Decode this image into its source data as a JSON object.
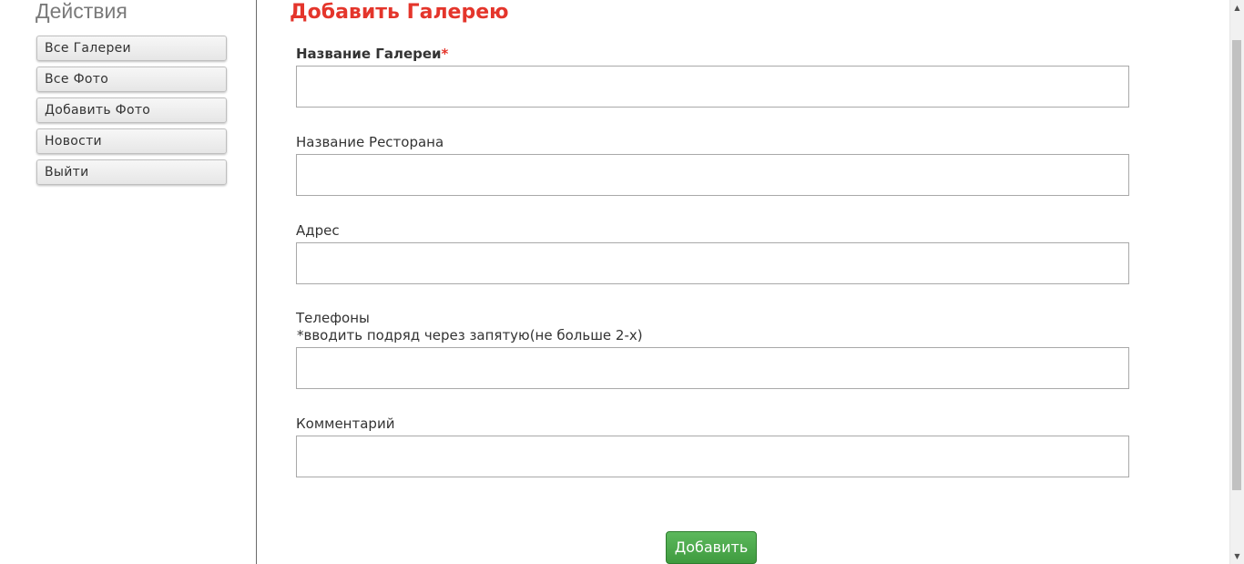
{
  "sidebar": {
    "title": "Действия",
    "items": [
      {
        "label": "Все Галереи"
      },
      {
        "label": "Все Фото"
      },
      {
        "label": "Добавить Фото"
      },
      {
        "label": "Новости"
      },
      {
        "label": "Выйти"
      }
    ]
  },
  "main": {
    "title": "Добавить Галерею",
    "fields": {
      "gallery_name": {
        "label": "Название Галереи",
        "required_mark": "*",
        "value": ""
      },
      "restaurant_name": {
        "label": "Название Ресторана",
        "value": ""
      },
      "address": {
        "label": "Адрес",
        "value": ""
      },
      "phones": {
        "label": "Телефоны",
        "hint": "*вводить подряд через запятую(не больше 2-х)",
        "value": ""
      },
      "comment": {
        "label": "Комментарий",
        "value": ""
      }
    },
    "submit_label": "Добавить"
  },
  "scrollbar": {
    "up_icon": "arrow-up-icon",
    "down_icon": "arrow-down-icon"
  },
  "colors": {
    "title_red": "#e4352b",
    "submit_green": "#4cae4c",
    "sidebar_title_gray": "#7a7a7a"
  }
}
